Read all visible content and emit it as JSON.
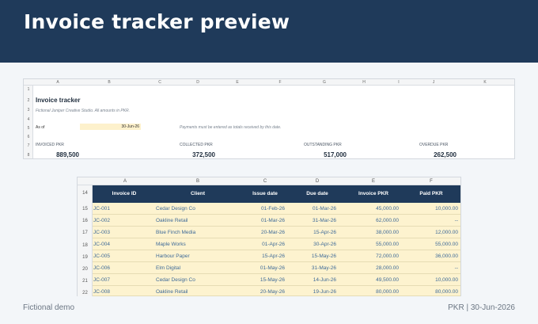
{
  "header": {
    "title": "Invoice tracker preview"
  },
  "summary_sheet": {
    "columns": [
      "A",
      "B",
      "C",
      "D",
      "E",
      "F",
      "G",
      "H",
      "I",
      "J",
      "K"
    ],
    "rows": [
      "1",
      "2",
      "3",
      "4",
      "5",
      "6",
      "7",
      "8"
    ],
    "title": "Invoice tracker",
    "subtitle": "Fictional Juniper Creative Studio. All amounts in PKR.",
    "as_of_label": "As of",
    "as_of_value": "30-Jun-26",
    "note": "Payments must be entered as totals received by this date.",
    "kpis": [
      {
        "label": "INVOICED PKR",
        "value": "889,500"
      },
      {
        "label": "COLLECTED PKR",
        "value": "372,500"
      },
      {
        "label": "OUTSTANDING PKR",
        "value": "517,000"
      },
      {
        "label": "OVERDUE PKR",
        "value": "262,500"
      }
    ]
  },
  "invoice_table": {
    "columns": [
      "A",
      "B",
      "C",
      "D",
      "E",
      "F"
    ],
    "header_row_number": "14",
    "headers": [
      "Invoice ID",
      "Client",
      "Issue date",
      "Due date",
      "Invoice PKR",
      "Paid PKR"
    ],
    "rows": [
      {
        "num": "15",
        "id": "JC-001",
        "client": "Cedar Design Co",
        "issue": "01-Feb-26",
        "due": "01-Mar-26",
        "invoice": "45,000.00",
        "paid": "10,000.00"
      },
      {
        "num": "16",
        "id": "JC-002",
        "client": "Oakline Retail",
        "issue": "01-Mar-26",
        "due": "31-Mar-26",
        "invoice": "62,000.00",
        "paid": "--"
      },
      {
        "num": "17",
        "id": "JC-003",
        "client": "Blue Finch Media",
        "issue": "20-Mar-26",
        "due": "15-Apr-26",
        "invoice": "38,000.00",
        "paid": "12,000.00"
      },
      {
        "num": "18",
        "id": "JC-004",
        "client": "Maple Works",
        "issue": "01-Apr-26",
        "due": "30-Apr-26",
        "invoice": "55,000.00",
        "paid": "55,000.00"
      },
      {
        "num": "19",
        "id": "JC-005",
        "client": "Harbour Paper",
        "issue": "15-Apr-26",
        "due": "15-May-26",
        "invoice": "72,000.00",
        "paid": "36,000.00"
      },
      {
        "num": "20",
        "id": "JC-006",
        "client": "Elm Digital",
        "issue": "01-May-26",
        "due": "31-May-26",
        "invoice": "28,000.00",
        "paid": "--"
      },
      {
        "num": "21",
        "id": "JC-007",
        "client": "Cedar Design Co",
        "issue": "15-May-26",
        "due": "14-Jun-26",
        "invoice": "49,500.00",
        "paid": "10,000.00"
      },
      {
        "num": "22",
        "id": "JC-008",
        "client": "Oakline Retail",
        "issue": "20-May-26",
        "due": "19-Jun-26",
        "invoice": "80,000.00",
        "paid": "80,000.00"
      }
    ]
  },
  "footer": {
    "left": "Fictional demo",
    "right": "PKR | 30-Jun-2026"
  }
}
